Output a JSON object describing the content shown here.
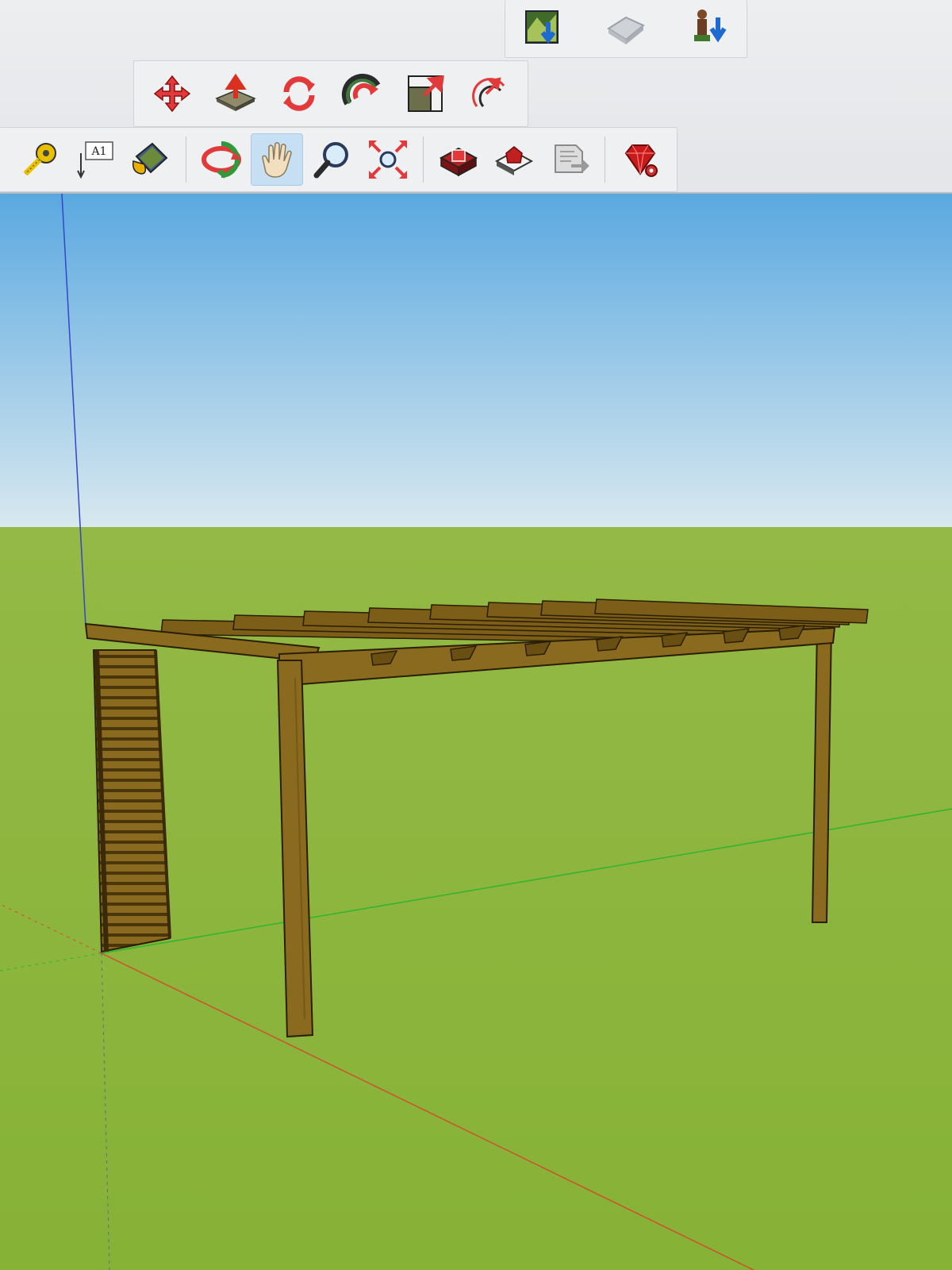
{
  "toolbars": {
    "top": [
      {
        "icon": "preview-model-in-google-earth-icon"
      },
      {
        "icon": "get-current-view-icon"
      },
      {
        "icon": "add-location-icon"
      }
    ],
    "edit": [
      {
        "icon": "move-tool-icon"
      },
      {
        "icon": "push-pull-tool-icon"
      },
      {
        "icon": "rotate-tool-icon"
      },
      {
        "icon": "follow-me-tool-icon"
      },
      {
        "icon": "scale-tool-icon"
      },
      {
        "icon": "offset-tool-icon"
      }
    ],
    "construction": [
      {
        "icon": "tape-measure-tool-icon"
      },
      {
        "icon": "text-tool-icon",
        "label": "A1"
      },
      {
        "icon": "paint-bucket-tool-icon"
      },
      {
        "icon": "orbit-tool-icon"
      },
      {
        "icon": "pan-tool-icon",
        "active": true
      },
      {
        "icon": "zoom-tool-icon"
      },
      {
        "icon": "zoom-extents-tool-icon"
      },
      {
        "icon": "3d-warehouse-icon"
      },
      {
        "icon": "extension-warehouse-icon"
      },
      {
        "icon": "layout-send-icon"
      },
      {
        "icon": "ruby-console-icon"
      }
    ]
  },
  "colors": {
    "sky_top": "#5aa8e0",
    "sky_bottom": "#d8e8ef",
    "ground": "#8fb83f",
    "wood": "#8a6a1e",
    "wood_dark": "#5e4612",
    "axis_red": "#d05030",
    "axis_green": "#2fb52f",
    "axis_blue": "#3346c7"
  }
}
